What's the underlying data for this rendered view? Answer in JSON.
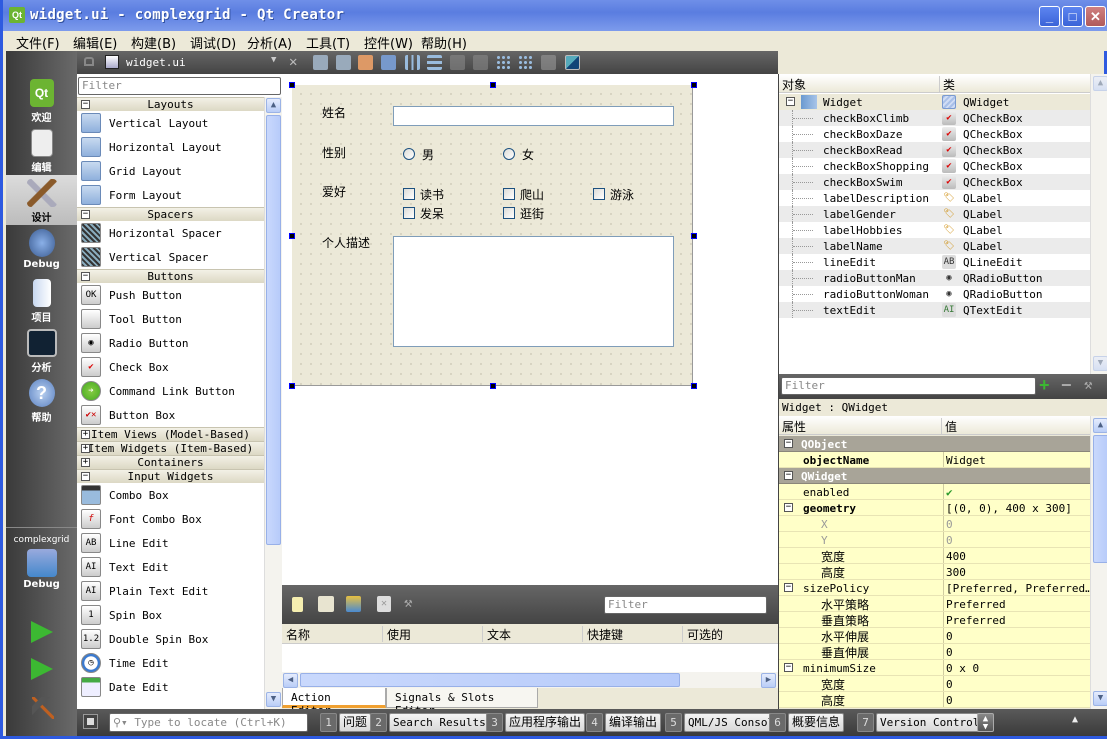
{
  "window": {
    "title": "widget.ui - complexgrid - Qt Creator",
    "logo": "Qt",
    "controls": {
      "minimize": "_",
      "maximize": "□",
      "close": "✕"
    }
  },
  "menubar": [
    "文件(F)",
    "编辑(E)",
    "构建(B)",
    "调试(D)",
    "分析(A)",
    "工具(T)",
    "控件(W)",
    "帮助(H)"
  ],
  "modes": [
    {
      "label": "欢迎",
      "icon": "qt-logo-icon"
    },
    {
      "label": "编辑",
      "icon": "edit-document-icon"
    },
    {
      "label": "设计",
      "icon": "design-brush-icon",
      "selected": true
    },
    {
      "label": "Debug",
      "icon": "bug-icon"
    },
    {
      "label": "项目",
      "icon": "project-folder-icon"
    },
    {
      "label": "分析",
      "icon": "analyze-monitor-icon"
    },
    {
      "label": "帮助",
      "icon": "help-icon"
    }
  ],
  "kit": {
    "project": "complexgrid",
    "mode": "Debug"
  },
  "editor_header": {
    "filename": "widget.ui"
  },
  "widget_box": {
    "filter_placeholder": "Filter",
    "categories": [
      {
        "name": "Layouts",
        "expanded": true,
        "items": [
          "Vertical Layout",
          "Horizontal Layout",
          "Grid Layout",
          "Form Layout"
        ]
      },
      {
        "name": "Spacers",
        "expanded": true,
        "items": [
          "Horizontal Spacer",
          "Vertical Spacer"
        ]
      },
      {
        "name": "Buttons",
        "expanded": true,
        "items": [
          "Push Button",
          "Tool Button",
          "Radio Button",
          "Check Box",
          "Command Link Button",
          "Button Box"
        ]
      },
      {
        "name": "Item Views (Model-Based)",
        "expanded": false,
        "items": []
      },
      {
        "name": "Item Widgets (Item-Based)",
        "expanded": false,
        "items": []
      },
      {
        "name": "Containers",
        "expanded": false,
        "items": []
      },
      {
        "name": "Input Widgets",
        "expanded": true,
        "items": [
          "Combo Box",
          "Font Combo Box",
          "Line Edit",
          "Text Edit",
          "Plain Text Edit",
          "Spin Box",
          "Double Spin Box",
          "Time Edit",
          "Date Edit"
        ]
      }
    ]
  },
  "form": {
    "label_name": "姓名",
    "label_gender": "性别",
    "radio_man": "男",
    "radio_woman": "女",
    "label_hobbies": "爱好",
    "hobbies": [
      "读书",
      "爬山",
      "游泳",
      "发呆",
      "逛街"
    ],
    "label_description": "个人描述"
  },
  "action_editor": {
    "filter_placeholder": "Filter",
    "columns": [
      "名称",
      "使用",
      "文本",
      "快捷键",
      "可选的"
    ],
    "tabs": [
      "Action Editor",
      "Signals & Slots Editor"
    ]
  },
  "object_inspector": {
    "columns": [
      "对象",
      "类"
    ],
    "root": {
      "name": "Widget",
      "class": "QWidget"
    },
    "children": [
      {
        "name": "checkBoxClimb",
        "class": "QCheckBox"
      },
      {
        "name": "checkBoxDaze",
        "class": "QCheckBox"
      },
      {
        "name": "checkBoxRead",
        "class": "QCheckBox"
      },
      {
        "name": "checkBoxShopping",
        "class": "QCheckBox"
      },
      {
        "name": "checkBoxSwim",
        "class": "QCheckBox"
      },
      {
        "name": "labelDescription",
        "class": "QLabel"
      },
      {
        "name": "labelGender",
        "class": "QLabel"
      },
      {
        "name": "labelHobbies",
        "class": "QLabel"
      },
      {
        "name": "labelName",
        "class": "QLabel"
      },
      {
        "name": "lineEdit",
        "class": "QLineEdit"
      },
      {
        "name": "radioButtonMan",
        "class": "QRadioButton"
      },
      {
        "name": "radioButtonWoman",
        "class": "QRadioButton"
      },
      {
        "name": "textEdit",
        "class": "QTextEdit"
      }
    ]
  },
  "property_editor": {
    "filter_placeholder": "Filter",
    "object_label": "Widget : QWidget",
    "columns": [
      "属性",
      "值"
    ],
    "rows": [
      {
        "type": "group",
        "key": "QObject"
      },
      {
        "type": "prop",
        "key": "objectName",
        "value": "Widget",
        "bold": true
      },
      {
        "type": "group",
        "key": "QWidget"
      },
      {
        "type": "prop",
        "key": "enabled",
        "value": "✔"
      },
      {
        "type": "prop",
        "key": "geometry",
        "value": "[(0, 0), 400 x 300]",
        "bold": true,
        "expandable": true
      },
      {
        "type": "sub",
        "key": "X",
        "value": "0",
        "gray": true
      },
      {
        "type": "sub",
        "key": "Y",
        "value": "0",
        "gray": true
      },
      {
        "type": "sub",
        "key": "宽度",
        "value": "400"
      },
      {
        "type": "sub",
        "key": "高度",
        "value": "300"
      },
      {
        "type": "prop",
        "key": "sizePolicy",
        "value": "[Preferred, Preferred…",
        "expandable": true
      },
      {
        "type": "sub",
        "key": "水平策略",
        "value": "Preferred"
      },
      {
        "type": "sub",
        "key": "垂直策略",
        "value": "Preferred"
      },
      {
        "type": "sub",
        "key": "水平伸展",
        "value": "0"
      },
      {
        "type": "sub",
        "key": "垂直伸展",
        "value": "0"
      },
      {
        "type": "prop",
        "key": "minimumSize",
        "value": "0 x 0",
        "expandable": true
      },
      {
        "type": "sub",
        "key": "宽度",
        "value": "0"
      },
      {
        "type": "sub",
        "key": "高度",
        "value": "0"
      }
    ]
  },
  "statusbar": {
    "locator_placeholder": "Type to locate (Ctrl+K)",
    "panes": [
      {
        "num": "1",
        "label": "问题"
      },
      {
        "num": "2",
        "label": "Search Results"
      },
      {
        "num": "3",
        "label": "应用程序输出"
      },
      {
        "num": "4",
        "label": "编译输出"
      },
      {
        "num": "5",
        "label": "QML/JS Console"
      },
      {
        "num": "6",
        "label": "概要信息"
      },
      {
        "num": "7",
        "label": "Version Control"
      }
    ]
  }
}
